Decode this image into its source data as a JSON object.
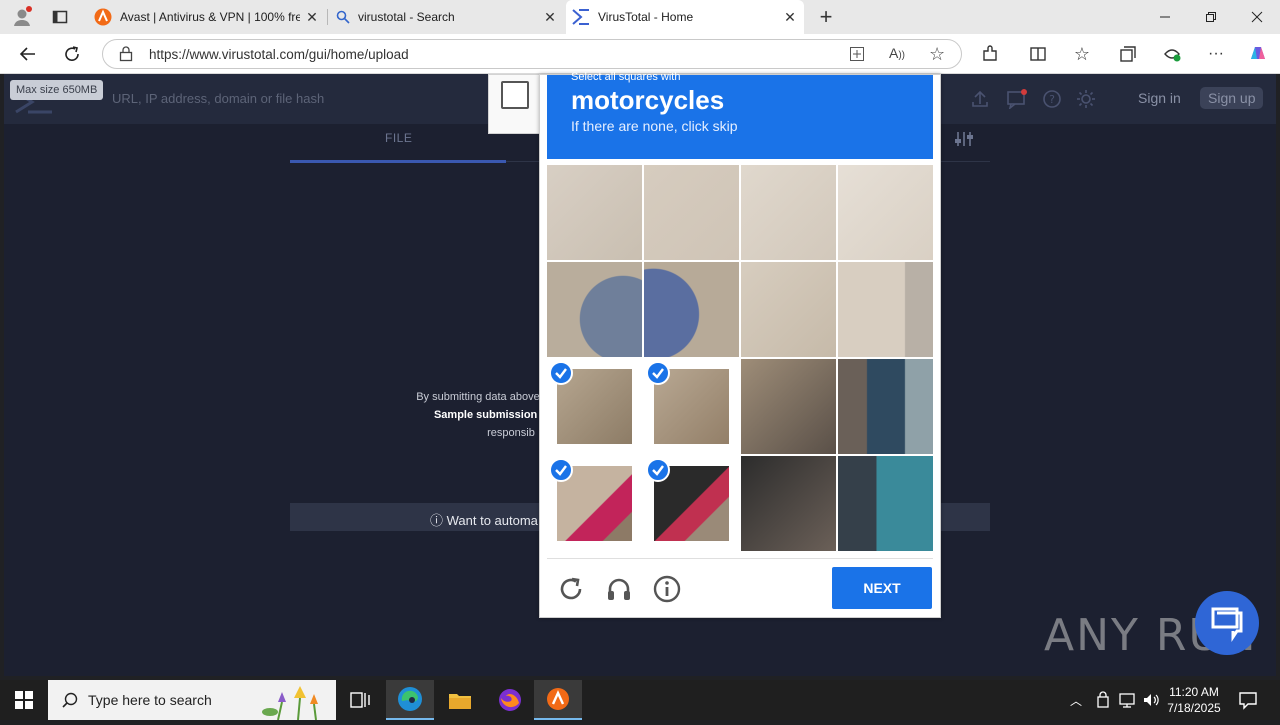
{
  "browser": {
    "tabs": [
      {
        "title": "Avast | Antivirus & VPN | 100% fre",
        "icon": "avast-icon"
      },
      {
        "title": "virustotal - Search",
        "icon": "search-icon"
      },
      {
        "title": "VirusTotal - Home",
        "icon": "virustotal-icon",
        "active": true
      }
    ],
    "url": "https://www.virustotal.com/gui/home/upload"
  },
  "page": {
    "max_size": "Max size 650MB",
    "search_placeholder": "URL, IP address, domain or file hash",
    "sign_in": "Sign in",
    "sign_up": "Sign up",
    "tab_file": "FILE",
    "submit_line1": "By submitting data above, you are ag",
    "submit_line2": "Sample submission with the secu",
    "submit_line3": "responsib",
    "automate": "Want to automa"
  },
  "captcha": {
    "pre_title": "Select all squares with",
    "target": "motorcycles",
    "hint": "If there are none, click skip",
    "next_label": "NEXT",
    "selected_tiles": [
      8,
      9,
      12,
      13
    ]
  },
  "watermark": "ANY RUN",
  "taskbar": {
    "search_placeholder": "Type here to search",
    "time": "11:20 AM",
    "date": "7/18/2025"
  },
  "colors": {
    "captcha_blue": "#1a73e8",
    "vt_bg": "#1c2030"
  }
}
